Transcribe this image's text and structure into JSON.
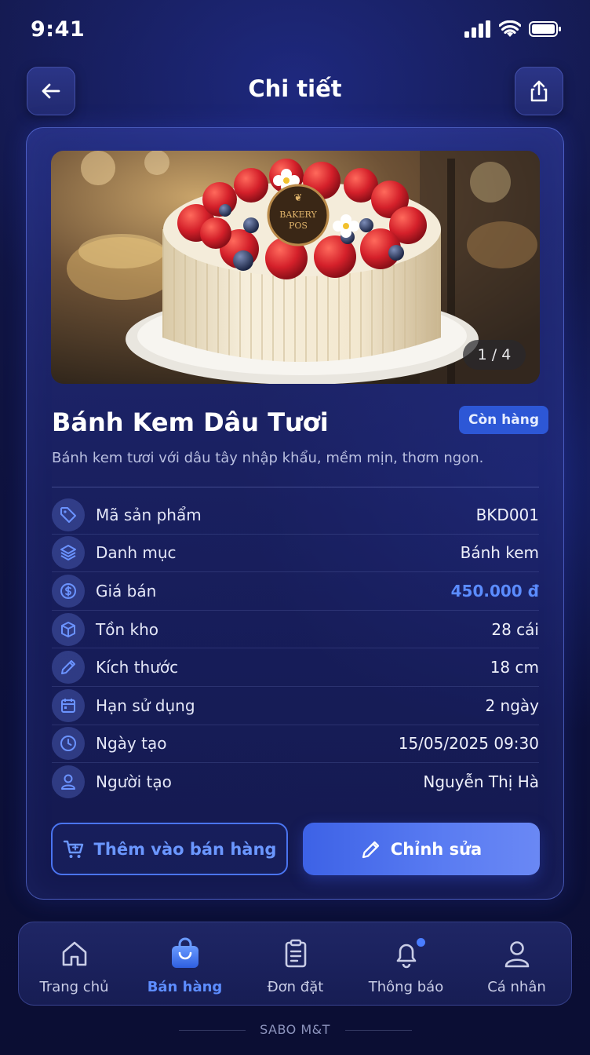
{
  "status_bar": {
    "time": "9:41"
  },
  "header": {
    "title": "Chi tiết"
  },
  "product": {
    "image_counter": "1 / 4",
    "cake_topper_text": "BAKERY POS",
    "name": "Bánh Kem Dâu Tươi",
    "stock_status": "Còn hàng",
    "description": "Bánh kem tươi với dâu tây nhập khẩu, mềm mịn, thơm ngon."
  },
  "info_rows": [
    {
      "icon": "tag-icon",
      "label": "Mã sản phẩm",
      "value": "BKD001"
    },
    {
      "icon": "layers-icon",
      "label": "Danh mục",
      "value": "Bánh kem"
    },
    {
      "icon": "dollar-circle-icon",
      "label": "Giá bán",
      "value": "450.000 đ"
    },
    {
      "icon": "box-icon",
      "label": "Tồn kho",
      "value": "28 cái"
    },
    {
      "icon": "pencil-icon",
      "label": "Kích thước",
      "value": "18 cm"
    },
    {
      "icon": "calendar-icon",
      "label": "Hạn sử dụng",
      "value": "2 ngày"
    },
    {
      "icon": "clock-icon",
      "label": "Ngày tạo",
      "value": "15/05/2025 09:30"
    },
    {
      "icon": "user-icon",
      "label": "Người tạo",
      "value": "Nguyễn Thị Hà"
    }
  ],
  "actions": {
    "add_to_sale": "Thêm vào bán hàng",
    "edit": "Chỉnh sửa"
  },
  "bottom_nav": [
    {
      "icon": "home-icon",
      "label": "Trang chủ",
      "active": false
    },
    {
      "icon": "shopping-bag-icon",
      "label": "Bán hàng",
      "active": true
    },
    {
      "icon": "clipboard-icon",
      "label": "Đơn đặt",
      "active": false
    },
    {
      "icon": "bell-icon",
      "label": "Thông báo",
      "active": false
    },
    {
      "icon": "profile-icon",
      "label": "Cá nhân",
      "active": false
    }
  ],
  "footer": {
    "brand": "SABO M&T"
  },
  "colors": {
    "accent": "#5b8cff",
    "badge": "#2d57d6",
    "primary_button": "#4a6ded",
    "background": "#11164a"
  }
}
